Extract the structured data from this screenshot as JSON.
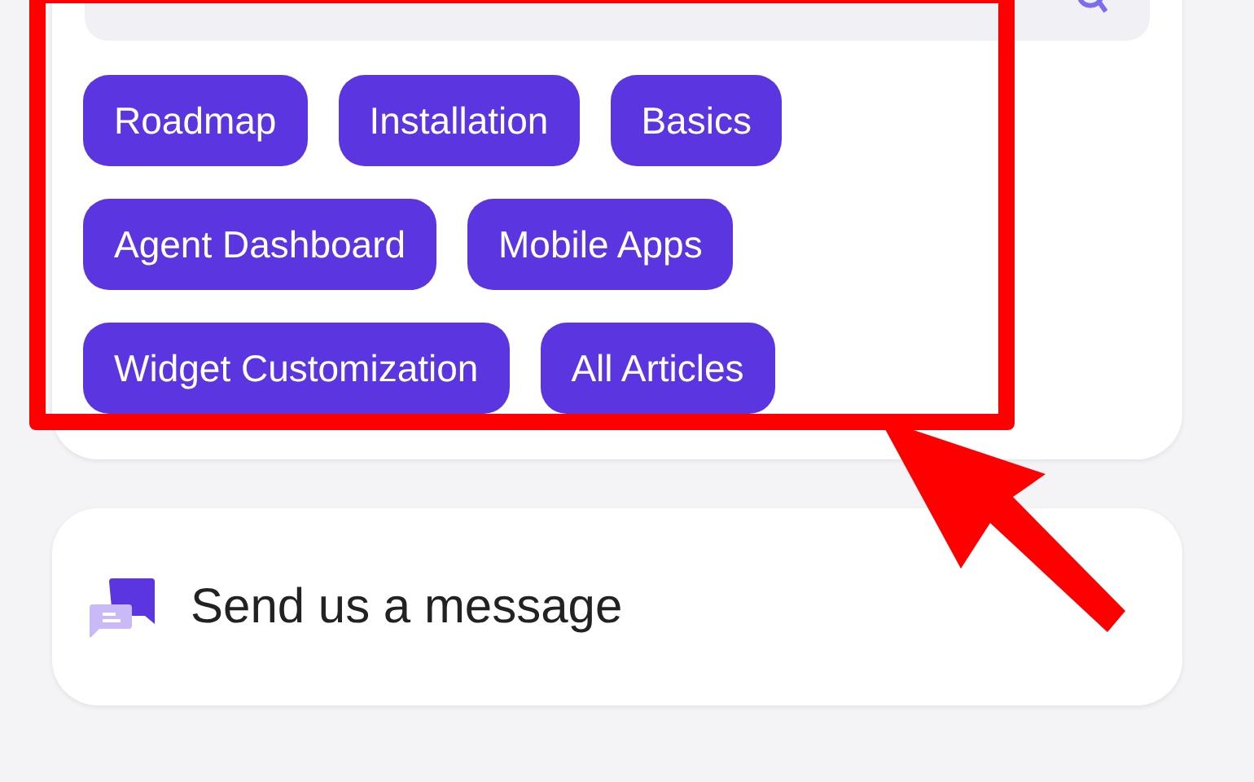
{
  "topics": [
    {
      "label": "Roadmap"
    },
    {
      "label": "Installation"
    },
    {
      "label": "Basics"
    },
    {
      "label": "Agent Dashboard"
    },
    {
      "label": "Mobile Apps"
    },
    {
      "label": "Widget Customization"
    },
    {
      "label": "All Articles"
    }
  ],
  "message_button": {
    "label": "Send us a message"
  }
}
